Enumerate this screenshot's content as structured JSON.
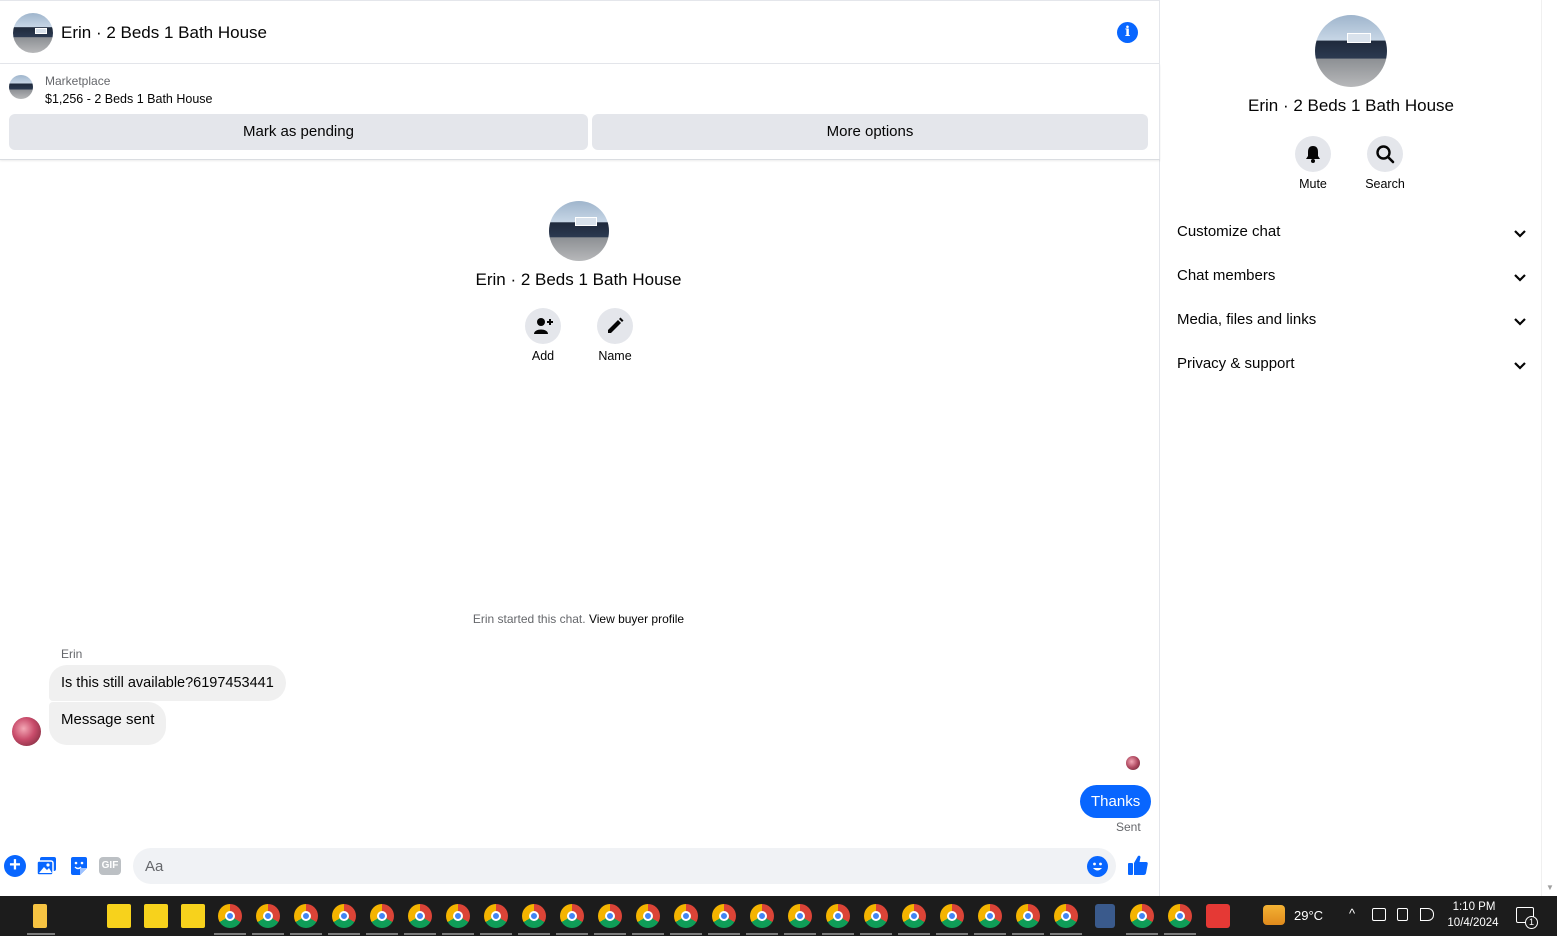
{
  "header": {
    "title": "Erin · 2 Beds 1 Bath House"
  },
  "listing": {
    "source": "Marketplace",
    "title": "$1,256 - 2 Beds 1 Bath House",
    "pending_label": "Mark as pending",
    "more_label": "More options"
  },
  "thread": {
    "title": "Erin · 2 Beds 1 Bath House",
    "add_label": "Add",
    "name_label": "Name",
    "started_text": "Erin started this chat.",
    "view_profile_label": "View buyer profile",
    "sender_name": "Erin",
    "messages_in": [
      "Is this still available?6197453441",
      "Message sent"
    ],
    "message_out": "Thanks",
    "sent_status": "Sent"
  },
  "composer": {
    "placeholder": "Aa",
    "gif_label": "GIF",
    "plus_label": "+"
  },
  "side": {
    "title": "Erin · 2 Beds 1 Bath House",
    "mute_label": "Mute",
    "search_label": "Search",
    "sections": [
      "Customize chat",
      "Chat members",
      "Media, files and links",
      "Privacy & support"
    ]
  },
  "taskbar": {
    "weather_temp": "29°C",
    "time": "1:10 PM",
    "date": "10/4/2024",
    "notification_count": "1"
  },
  "colors": {
    "accent": "#0866ff",
    "bubble_in": "#f0f0f0",
    "button_bg": "#e4e6eb",
    "taskbar": "#1c1c1c"
  },
  "icons": [
    "info-icon",
    "add-person-icon",
    "pencil-icon",
    "bell-icon",
    "search-icon",
    "chevron-down-icon",
    "plus-icon",
    "photo-icon",
    "sticker-icon",
    "gif-icon",
    "emoji-icon",
    "like-icon"
  ]
}
